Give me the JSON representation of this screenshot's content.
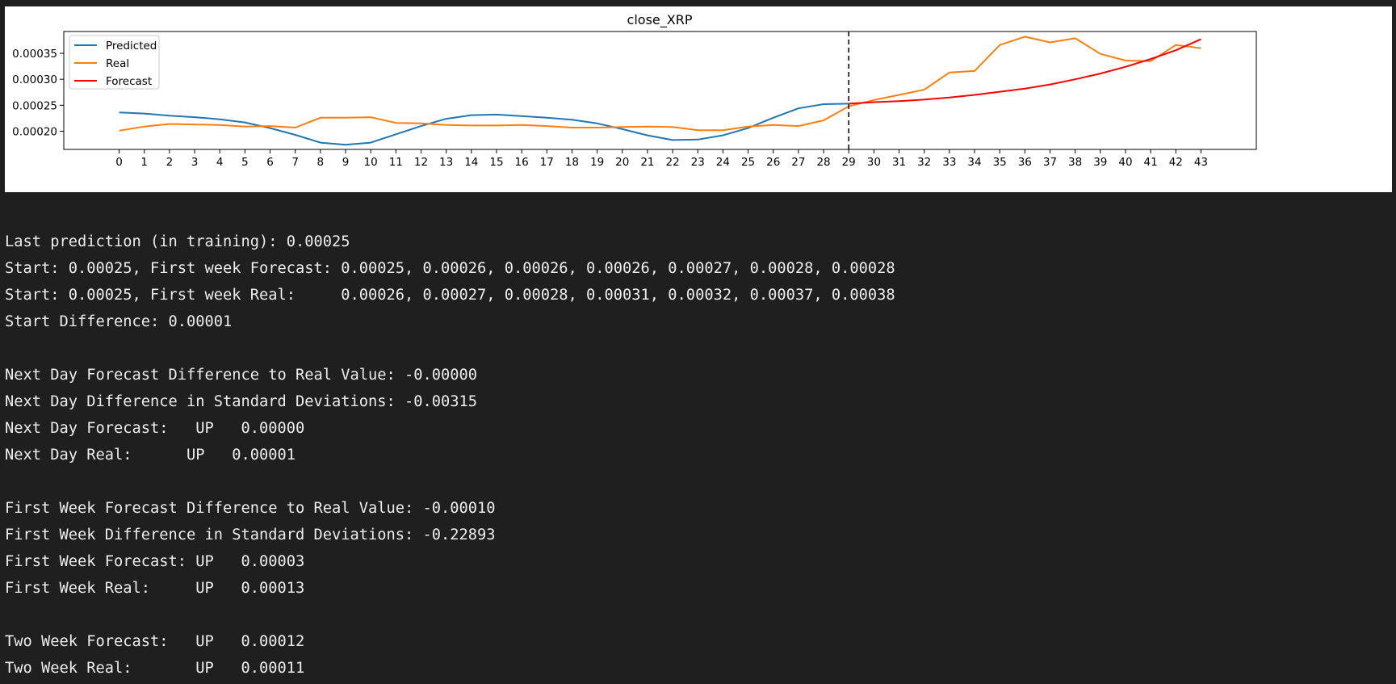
{
  "chart_data": {
    "type": "line",
    "title": "close_XRP",
    "xlabel": "",
    "ylabel": "",
    "x_ticks": [
      "0",
      "1",
      "2",
      "3",
      "4",
      "5",
      "6",
      "7",
      "8",
      "9",
      "10",
      "11",
      "12",
      "13",
      "14",
      "15",
      "16",
      "17",
      "18",
      "19",
      "20",
      "21",
      "22",
      "23",
      "24",
      "25",
      "26",
      "27",
      "28",
      "29",
      "30",
      "31",
      "32",
      "33",
      "34",
      "35",
      "36",
      "37",
      "38",
      "39",
      "40",
      "41",
      "42",
      "43"
    ],
    "xlim": [
      -2.2,
      45.2
    ],
    "ylim": [
      0.000165,
      0.000392
    ],
    "y_ticks": [
      0.0002,
      0.00025,
      0.0003,
      0.00035
    ],
    "y_tick_labels": [
      "0.00020",
      "0.00025",
      "0.00030",
      "0.00035"
    ],
    "vline_x": 29,
    "legend_position": "upper-left",
    "grid": false,
    "series": [
      {
        "name": "Predicted",
        "color": "#1f77b4",
        "x": [
          0,
          1,
          2,
          3,
          4,
          5,
          6,
          7,
          8,
          9,
          10,
          11,
          12,
          13,
          14,
          15,
          16,
          17,
          18,
          19,
          20,
          21,
          22,
          23,
          24,
          25,
          26,
          27,
          28,
          29
        ],
        "values": [
          0.000236,
          0.000234,
          0.00023,
          0.000227,
          0.000223,
          0.000217,
          0.000206,
          0.000193,
          0.000178,
          0.000174,
          0.000178,
          0.000194,
          0.00021,
          0.000224,
          0.000231,
          0.000232,
          0.000229,
          0.000226,
          0.000222,
          0.000215,
          0.000204,
          0.000192,
          0.000183,
          0.000184,
          0.000192,
          0.000206,
          0.000226,
          0.000244,
          0.000252,
          0.000253
        ]
      },
      {
        "name": "Real",
        "color": "#ff7f0e",
        "x": [
          0,
          1,
          2,
          3,
          4,
          5,
          6,
          7,
          8,
          9,
          10,
          11,
          12,
          13,
          14,
          15,
          16,
          17,
          18,
          19,
          20,
          21,
          22,
          23,
          24,
          25,
          26,
          27,
          28,
          29,
          30,
          31,
          32,
          33,
          34,
          35,
          36,
          37,
          38,
          39,
          40,
          41,
          42,
          43
        ],
        "values": [
          0.000201,
          0.000209,
          0.000214,
          0.000213,
          0.000212,
          0.000209,
          0.00021,
          0.000207,
          0.000226,
          0.000226,
          0.000227,
          0.000216,
          0.000215,
          0.000212,
          0.000211,
          0.000211,
          0.000212,
          0.00021,
          0.000207,
          0.000207,
          0.000208,
          0.000209,
          0.000208,
          0.000202,
          0.000202,
          0.000209,
          0.000212,
          0.00021,
          0.000221,
          0.000248,
          0.00026,
          0.00027,
          0.00028,
          0.000313,
          0.000316,
          0.000366,
          0.000382,
          0.000371,
          0.000379,
          0.000349,
          0.000336,
          0.000335,
          0.000366,
          0.00036
        ]
      },
      {
        "name": "Forecast",
        "color": "#ff0000",
        "x": [
          29,
          30,
          31,
          32,
          33,
          34,
          35,
          36,
          37,
          38,
          39,
          40,
          41,
          42,
          43
        ],
        "values": [
          0.000253,
          0.000256,
          0.000258,
          0.000261,
          0.000265,
          0.00027,
          0.000276,
          0.000282,
          0.00029,
          0.0003,
          0.000311,
          0.000324,
          0.000339,
          0.000356,
          0.000377
        ]
      }
    ]
  },
  "output_lines": [
    "Last prediction (in training): 0.00025",
    "Start: 0.00025, First week Forecast: 0.00025, 0.00026, 0.00026, 0.00026, 0.00027, 0.00028, 0.00028",
    "Start: 0.00025, First week Real:     0.00026, 0.00027, 0.00028, 0.00031, 0.00032, 0.00037, 0.00038",
    "Start Difference: 0.00001",
    "",
    "Next Day Forecast Difference to Real Value: -0.00000",
    "Next Day Difference in Standard Deviations: -0.00315",
    "Next Day Forecast:   UP   0.00000",
    "Next Day Real:      UP   0.00001",
    "",
    "First Week Forecast Difference to Real Value: -0.00010",
    "First Week Difference in Standard Deviations: -0.22893",
    "First Week Forecast: UP   0.00003",
    "First Week Real:     UP   0.00013",
    "",
    "Two Week Forecast:   UP   0.00012",
    "Two Week Real:       UP   0.00011"
  ]
}
